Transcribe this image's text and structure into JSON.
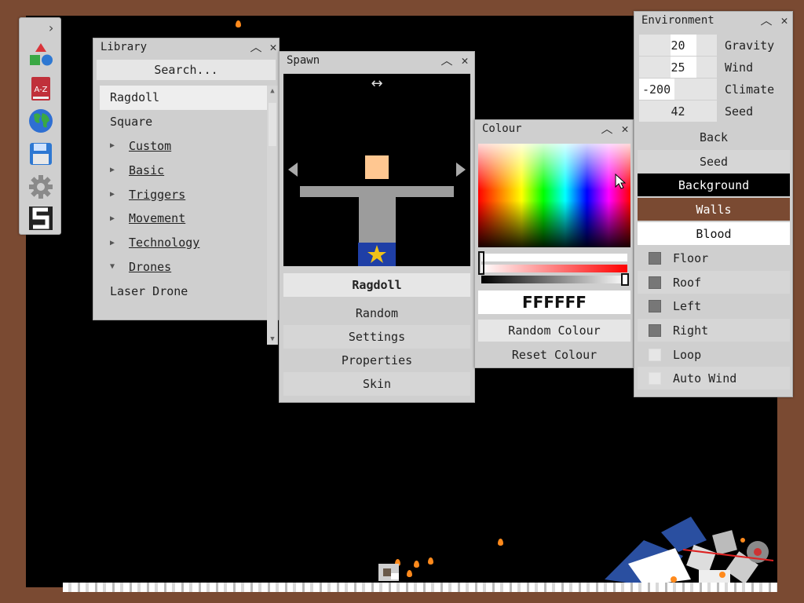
{
  "library": {
    "title": "Library",
    "search_placeholder": "Search...",
    "items": [
      {
        "label": "Ragdoll",
        "kind": "item",
        "selected": true
      },
      {
        "label": "Square",
        "kind": "item"
      },
      {
        "label": "Custom",
        "kind": "folder",
        "expanded": false
      },
      {
        "label": "Basic",
        "kind": "folder",
        "expanded": false
      },
      {
        "label": "Triggers",
        "kind": "folder",
        "expanded": false
      },
      {
        "label": "Movement",
        "kind": "folder",
        "expanded": false
      },
      {
        "label": "Technology",
        "kind": "folder",
        "expanded": false
      },
      {
        "label": "Drones",
        "kind": "folder",
        "expanded": true
      },
      {
        "label": "Laser Drone",
        "kind": "item"
      }
    ]
  },
  "spawn": {
    "title": "Spawn",
    "selected_name": "Ragdoll",
    "buttons": [
      "Random",
      "Settings",
      "Properties",
      "Skin"
    ]
  },
  "colour": {
    "title": "Colour",
    "hex": "FFFFFF",
    "random_label": "Random Colour",
    "reset_label": "Reset Colour"
  },
  "environment": {
    "title": "Environment",
    "fields": [
      {
        "value": "20",
        "label": "Gravity"
      },
      {
        "value": "25",
        "label": "Wind"
      },
      {
        "value": "-200",
        "label": "Climate"
      },
      {
        "value": "42",
        "label": "Seed"
      }
    ],
    "back_label": "Back",
    "seed_label": "Seed",
    "background_label": "Background",
    "walls_label": "Walls",
    "blood_label": "Blood",
    "toggles": [
      {
        "label": "Floor",
        "on": true
      },
      {
        "label": "Roof",
        "on": true
      },
      {
        "label": "Left",
        "on": true
      },
      {
        "label": "Right",
        "on": true
      },
      {
        "label": "Loop",
        "on": false
      },
      {
        "label": "Auto Wind",
        "on": false
      }
    ]
  },
  "toolbar": {
    "icons": [
      "collapse-arrow-icon",
      "shapes-icon",
      "a-z-library-icon",
      "globe-icon",
      "save-icon",
      "settings-gear-icon",
      "logo-s-icon"
    ]
  },
  "colors": {
    "walls": "#7a4a32",
    "background": "#000000",
    "blood": "#ffffff",
    "panel": "#cfcfcf"
  }
}
